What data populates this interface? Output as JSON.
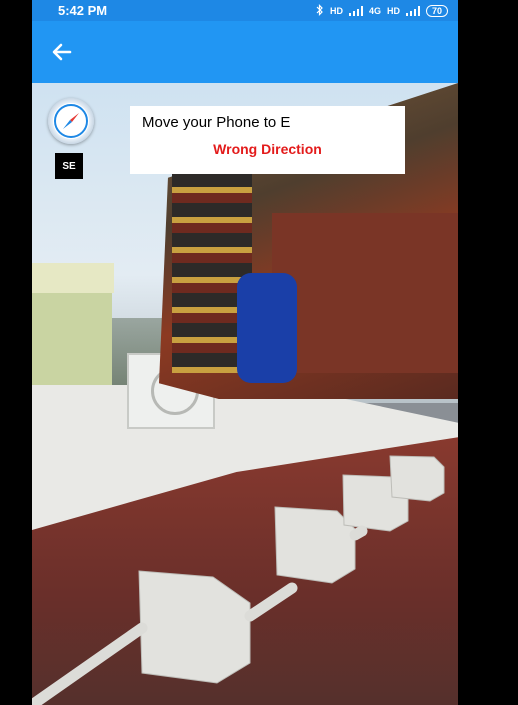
{
  "status_bar": {
    "time": "5:42 PM",
    "network_labels": [
      "HD",
      "4G",
      "HD"
    ],
    "battery": "70"
  },
  "app_bar": {
    "back_icon": "arrow-left-icon"
  },
  "ar_overlay": {
    "compass_icon": "compass-icon",
    "current_heading": "SE",
    "instruction": "Move your Phone to E",
    "warning": "Wrong Direction",
    "warning_color": "#e31b1b",
    "accent_color": "#2196f3"
  }
}
